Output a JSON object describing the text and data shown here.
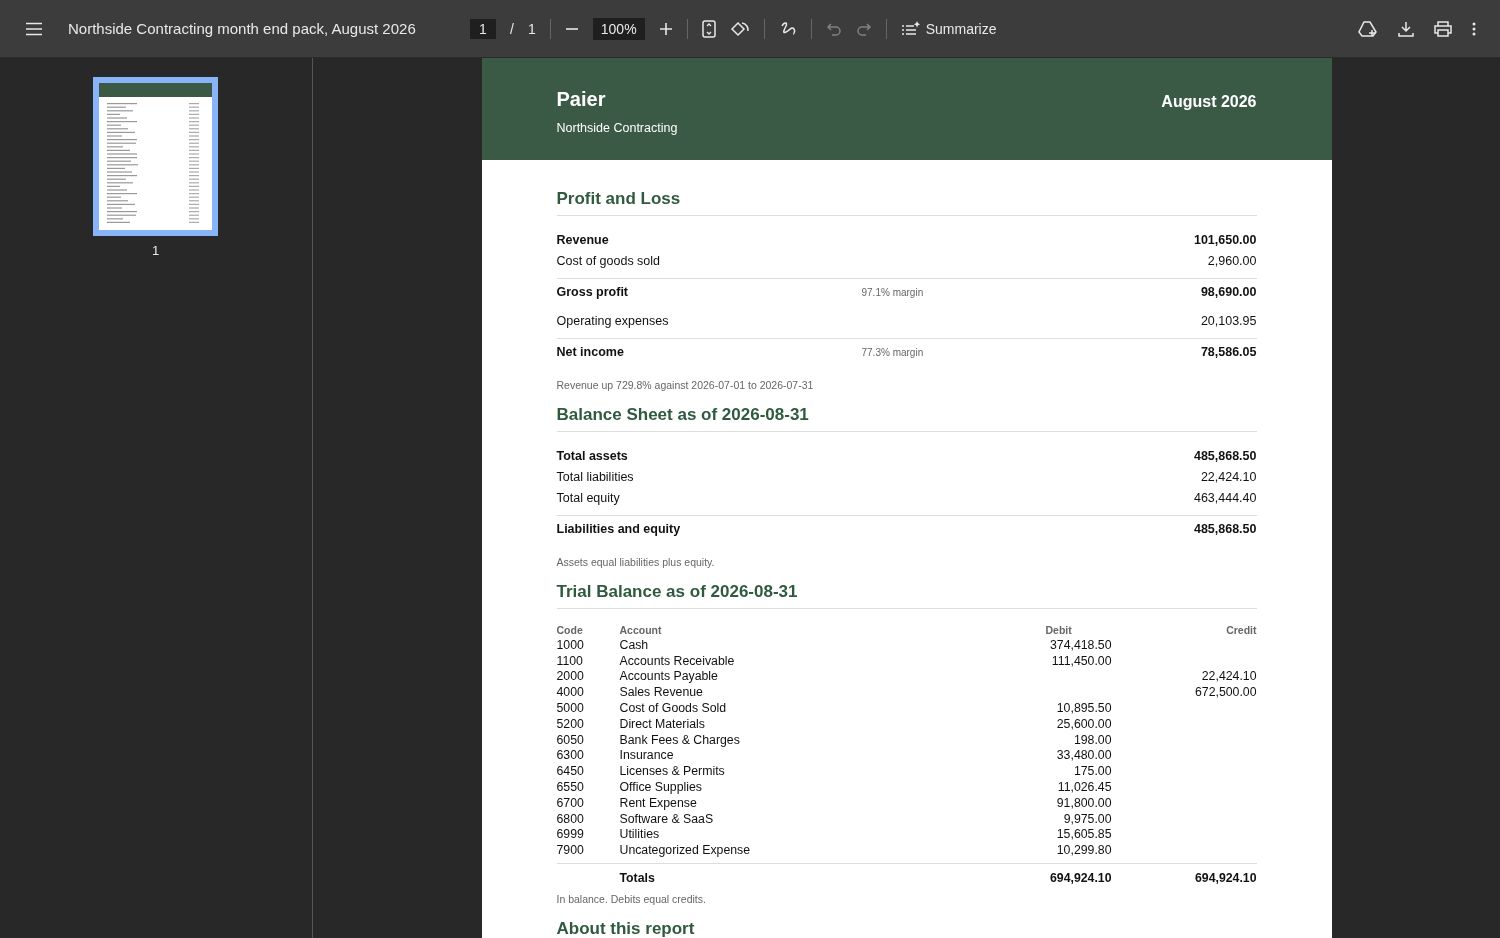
{
  "toolbar": {
    "title": "Northside Contracting month end pack, August 2026",
    "page_input": "1",
    "page_separator": "/",
    "page_count": "1",
    "zoom": "100%",
    "undo_disabled": true,
    "redo_disabled": true,
    "summarize": "Summarize"
  },
  "sidebar": {
    "thumbnails": [
      {
        "label": "1",
        "selected": true
      }
    ]
  },
  "document": {
    "header": {
      "brand": "Paier",
      "company": "Northside Contracting",
      "period": "August 2026"
    },
    "profit_and_loss": {
      "heading": "Profit and Loss",
      "rows": [
        {
          "label": "Revenue",
          "value": "101,650.00",
          "bold": true,
          "divider_above": false
        },
        {
          "label": "Cost of goods sold",
          "value": "2,960.00",
          "bold": false,
          "divider_above": false
        },
        {
          "label": "Gross profit",
          "note": "97.1% margin",
          "value": "98,690.00",
          "bold": true,
          "divider_above": true
        },
        {
          "label": "Operating expenses",
          "value": "20,103.95",
          "bold": false,
          "divider_above": false
        },
        {
          "label": "Net income",
          "note": "77.3% margin",
          "value": "78,586.05",
          "bold": true,
          "divider_above": true
        }
      ],
      "footnote": "Revenue up 729.8% against 2026-07-01 to 2026-07-31"
    },
    "balance_sheet": {
      "heading": "Balance Sheet as of 2026-08-31",
      "rows": [
        {
          "label": "Total assets",
          "value": "485,868.50",
          "bold": true,
          "divider_above": false
        },
        {
          "label": "Total liabilities",
          "value": "22,424.10",
          "bold": false,
          "divider_above": false
        },
        {
          "label": "Total equity",
          "value": "463,444.40",
          "bold": false,
          "divider_above": false
        },
        {
          "label": "Liabilities and equity",
          "value": "485,868.50",
          "bold": true,
          "divider_above": true
        }
      ],
      "footnote": "Assets equal liabilities plus equity."
    },
    "trial_balance": {
      "heading": "Trial Balance as of 2026-08-31",
      "columns": [
        "Code",
        "Account",
        "Debit",
        "Credit"
      ],
      "rows": [
        {
          "code": "1000",
          "account": "Cash",
          "debit": "374,418.50"
        },
        {
          "code": "1100",
          "account": "Accounts Receivable",
          "debit": "111,450.00"
        },
        {
          "code": "2000",
          "account": "Accounts Payable",
          "credit": "22,424.10"
        },
        {
          "code": "4000",
          "account": "Sales Revenue",
          "credit": "672,500.00"
        },
        {
          "code": "5000",
          "account": "Cost of Goods Sold",
          "debit": "10,895.50"
        },
        {
          "code": "5200",
          "account": "Direct Materials",
          "debit": "25,600.00"
        },
        {
          "code": "6050",
          "account": "Bank Fees & Charges",
          "debit": "198.00"
        },
        {
          "code": "6300",
          "account": "Insurance",
          "debit": "33,480.00"
        },
        {
          "code": "6450",
          "account": "Licenses & Permits",
          "debit": "175.00"
        },
        {
          "code": "6550",
          "account": "Office Supplies",
          "debit": "11,026.45"
        },
        {
          "code": "6700",
          "account": "Rent Expense",
          "debit": "91,800.00"
        },
        {
          "code": "6800",
          "account": "Software & SaaS",
          "debit": "9,975.00"
        },
        {
          "code": "6999",
          "account": "Utilities",
          "debit": "15,605.85"
        },
        {
          "code": "7900",
          "account": "Uncategorized Expense",
          "debit": "10,299.80"
        }
      ],
      "totals": {
        "label": "Totals",
        "debit": "694,924.10",
        "credit": "694,924.10"
      },
      "footnote": "In balance. Debits equal credits."
    },
    "about": {
      "heading": "About this report"
    }
  }
}
